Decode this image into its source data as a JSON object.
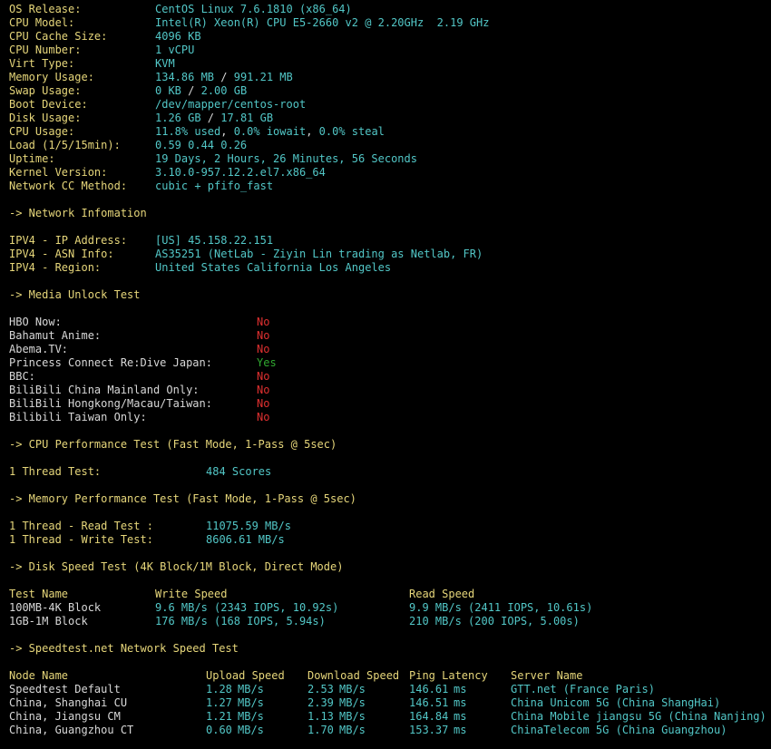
{
  "system": [
    {
      "label": "OS Release:",
      "value": "CentOS Linux 7.6.1810 (x86_64)"
    },
    {
      "label": "CPU Model:",
      "value": "Intel(R) Xeon(R) CPU E5-2660 v2 @ 2.20GHz  2.19 GHz"
    },
    {
      "label": "CPU Cache Size:",
      "value": "4096 KB"
    },
    {
      "label": "CPU Number:",
      "value": "1 vCPU"
    },
    {
      "label": "Virt Type:",
      "value": "KVM"
    },
    {
      "label": "Memory Usage:",
      "v1": "134.86 MB",
      "sep": " / ",
      "v2": "991.21 MB"
    },
    {
      "label": "Swap Usage:",
      "v1": "0 KB",
      "sep": " / ",
      "v2": "2.00 GB"
    },
    {
      "label": "Boot Device:",
      "value": "/dev/mapper/centos-root"
    },
    {
      "label": "Disk Usage:",
      "v1": "1.26 GB",
      "sep": " / ",
      "v2": "17.81 GB"
    },
    {
      "label": "CPU Usage:",
      "v1": "11.8% used",
      "sep1": ", ",
      "v2": "0.0% iowait",
      "sep2": ", ",
      "v3": "0.0% steal"
    },
    {
      "label": "Load (1/5/15min):",
      "value": "0.59 0.44 0.26"
    },
    {
      "label": "Uptime:",
      "value": "19 Days, 2 Hours, 26 Minutes, 56 Seconds"
    },
    {
      "label": "Kernel Version:",
      "value": "3.10.0-957.12.2.el7.x86_64"
    },
    {
      "label": "Network CC Method:",
      "value": "cubic + pfifo_fast"
    }
  ],
  "network_header": "-> Network Infomation",
  "network": [
    {
      "label": "IPV4 - IP Address:",
      "value": "[US] 45.158.22.151"
    },
    {
      "label": "IPV4 - ASN Info:",
      "value": "AS35251 (NetLab - Ziyin Lin trading as Netlab, FR)"
    },
    {
      "label": "IPV4 - Region:",
      "value": "United States California Los Angeles"
    }
  ],
  "media_header": "-> Media Unlock Test",
  "media": [
    {
      "label": "HBO Now:",
      "value": "No",
      "status": "no"
    },
    {
      "label": "Bahamut Anime:",
      "value": "No",
      "status": "no"
    },
    {
      "label": "Abema.TV:",
      "value": "No",
      "status": "no"
    },
    {
      "label": "Princess Connect Re:Dive Japan:",
      "value": "Yes",
      "status": "yes"
    },
    {
      "label": "BBC:",
      "value": "No",
      "status": "no"
    },
    {
      "label": "BiliBili China Mainland Only:",
      "value": "No",
      "status": "no"
    },
    {
      "label": "BiliBili Hongkong/Macau/Taiwan:",
      "value": "No",
      "status": "no"
    },
    {
      "label": "Bilibili Taiwan Only:",
      "value": "No",
      "status": "no"
    }
  ],
  "cpu_header": "-> CPU Performance Test (Fast Mode, 1-Pass @ 5sec)",
  "cpu_test": {
    "label": "1 Thread Test:",
    "value": "484 Scores"
  },
  "mem_header": "-> Memory Performance Test (Fast Mode, 1-Pass @ 5sec)",
  "mem_tests": [
    {
      "label": "1 Thread - Read Test :",
      "value": "11075.59 MB/s"
    },
    {
      "label": "1 Thread - Write Test:",
      "value": "8606.61 MB/s"
    }
  ],
  "disk_header": "-> Disk Speed Test (4K Block/1M Block, Direct Mode)",
  "disk_columns": [
    "Test Name",
    "Write Speed",
    "Read Speed"
  ],
  "disk_rows": [
    {
      "name": "100MB-4K Block",
      "write": "9.6 MB/s (2343 IOPS, 10.92s)",
      "read": "9.9 MB/s (2411 IOPS, 10.61s)"
    },
    {
      "name": "1GB-1M Block",
      "write": "176 MB/s (168 IOPS, 5.94s)",
      "read": "210 MB/s (200 IOPS, 5.00s)"
    }
  ],
  "speed_header": "-> Speedtest.net Network Speed Test",
  "speed_columns": [
    "Node Name",
    "Upload Speed",
    "Download Speed",
    "Ping Latency",
    "Server Name"
  ],
  "speed_rows": [
    {
      "node": "Speedtest Default",
      "up": "1.28",
      "up_u": "MB/s",
      "down": "2.53",
      "down_u": "MB/s",
      "ping": "146.61",
      "ping_u": "ms",
      "server": "GTT.net (France Paris)"
    },
    {
      "node": "China, Shanghai CU",
      "up": "1.27",
      "up_u": "MB/s",
      "down": "2.39",
      "down_u": "MB/s",
      "ping": "146.51",
      "ping_u": "ms",
      "server": "China Unicom 5G (China ShangHai)"
    },
    {
      "node": "China, Jiangsu CM",
      "up": "1.21",
      "up_u": "MB/s",
      "down": "1.13",
      "down_u": "MB/s",
      "ping": "164.84",
      "ping_u": "ms",
      "server": "China Mobile jiangsu 5G (China Nanjing)"
    },
    {
      "node": "China, Guangzhou CT",
      "up": "0.60",
      "up_u": "MB/s",
      "down": "1.70",
      "down_u": "MB/s",
      "ping": "153.37",
      "ping_u": "ms",
      "server": "ChinaTelecom 5G (China Guangzhou)"
    }
  ],
  "colors": {
    "label": "#e6d67a",
    "value": "#52c7c7",
    "text": "#d8d8d8",
    "no": "#e03030",
    "yes": "#30a830",
    "background": "#000000"
  }
}
